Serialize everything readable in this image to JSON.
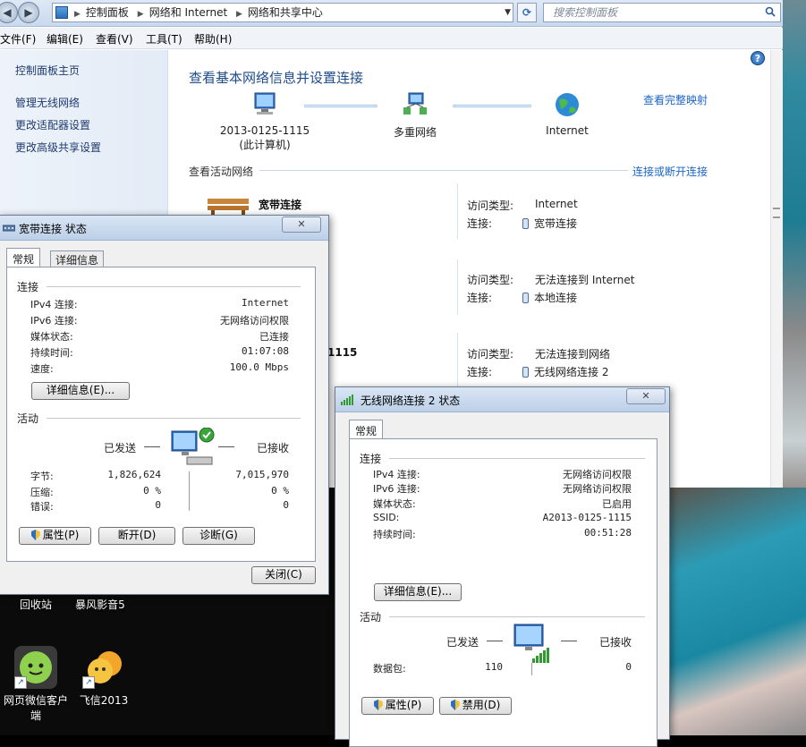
{
  "address": {
    "crumbs": [
      "控制面板",
      "网络和 Internet",
      "网络和共享中心"
    ],
    "search_placeholder": "搜索控制面板"
  },
  "menu": [
    "文件(F)",
    "编辑(E)",
    "查看(V)",
    "工具(T)",
    "帮助(H)"
  ],
  "sidebar": {
    "home": "控制面板主页",
    "links": [
      "管理无线网络",
      "更改适配器设置",
      "更改高级共享设置"
    ]
  },
  "content": {
    "title": "查看基本网络信息并设置连接",
    "map_link": "查看完整映射",
    "nodes": [
      {
        "name": "2013-0125-1115",
        "sub": "(此计算机)"
      },
      {
        "name": "多重网络",
        "sub": ""
      },
      {
        "name": "Internet",
        "sub": ""
      }
    ],
    "active_header": "查看活动网络",
    "connect_link": "连接或断开连接",
    "networks": [
      {
        "name": "宽带连接",
        "access_label": "访问类型:",
        "access": "Internet",
        "conn_label": "连接:",
        "conn": "宽带连接"
      },
      {
        "name": "",
        "access_label": "访问类型:",
        "access": "无法连接到 Internet",
        "conn_label": "连接:",
        "conn": "本地连接"
      },
      {
        "name": "1115",
        "access_label": "访问类型:",
        "access": "无法连接到网络",
        "conn_label": "连接:",
        "conn": "无线网络连接 2"
      }
    ]
  },
  "desktop": {
    "icons": [
      "回收站",
      "暴风影音5",
      "网页微信客户端",
      "飞信2013"
    ]
  },
  "dialog1": {
    "title": "宽带连接 状态",
    "tabs": [
      "常规",
      "详细信息"
    ],
    "section_conn": "连接",
    "rows": [
      {
        "label": "IPv4 连接:",
        "value": "Internet"
      },
      {
        "label": "IPv6 连接:",
        "value": "无网络访问权限"
      },
      {
        "label": "媒体状态:",
        "value": "已连接"
      },
      {
        "label": "持续时间:",
        "value": "01:07:08"
      },
      {
        "label": "速度:",
        "value": "100.0 Mbps"
      }
    ],
    "details_btn": "详细信息(E)...",
    "section_activity": "活动",
    "sent": "已发送",
    "received": "已接收",
    "stats": [
      {
        "label": "字节:",
        "sent": "1,826,624",
        "recv": "7,015,970"
      },
      {
        "label": "压缩:",
        "sent": "0 %",
        "recv": "0 %"
      },
      {
        "label": "错误:",
        "sent": "0",
        "recv": "0"
      }
    ],
    "buttons": [
      "属性(P)",
      "断开(D)",
      "诊断(G)"
    ],
    "close_btn": "关闭(C)"
  },
  "dialog2": {
    "title": "无线网络连接 2 状态",
    "tab": "常规",
    "section_conn": "连接",
    "rows": [
      {
        "label": "IPv4 连接:",
        "value": "无网络访问权限"
      },
      {
        "label": "IPv6 连接:",
        "value": "无网络访问权限"
      },
      {
        "label": "媒体状态:",
        "value": "已启用"
      },
      {
        "label": "SSID:",
        "value": "A2013-0125-1115"
      },
      {
        "label": "持续时间:",
        "value": "00:51:28"
      }
    ],
    "details_btn": "详细信息(E)...",
    "section_activity": "活动",
    "sent": "已发送",
    "received": "已接收",
    "packets_label": "数据包:",
    "packets_sent": "110",
    "packets_recv": "0",
    "buttons": [
      "属性(P)",
      "禁用(D)"
    ]
  }
}
